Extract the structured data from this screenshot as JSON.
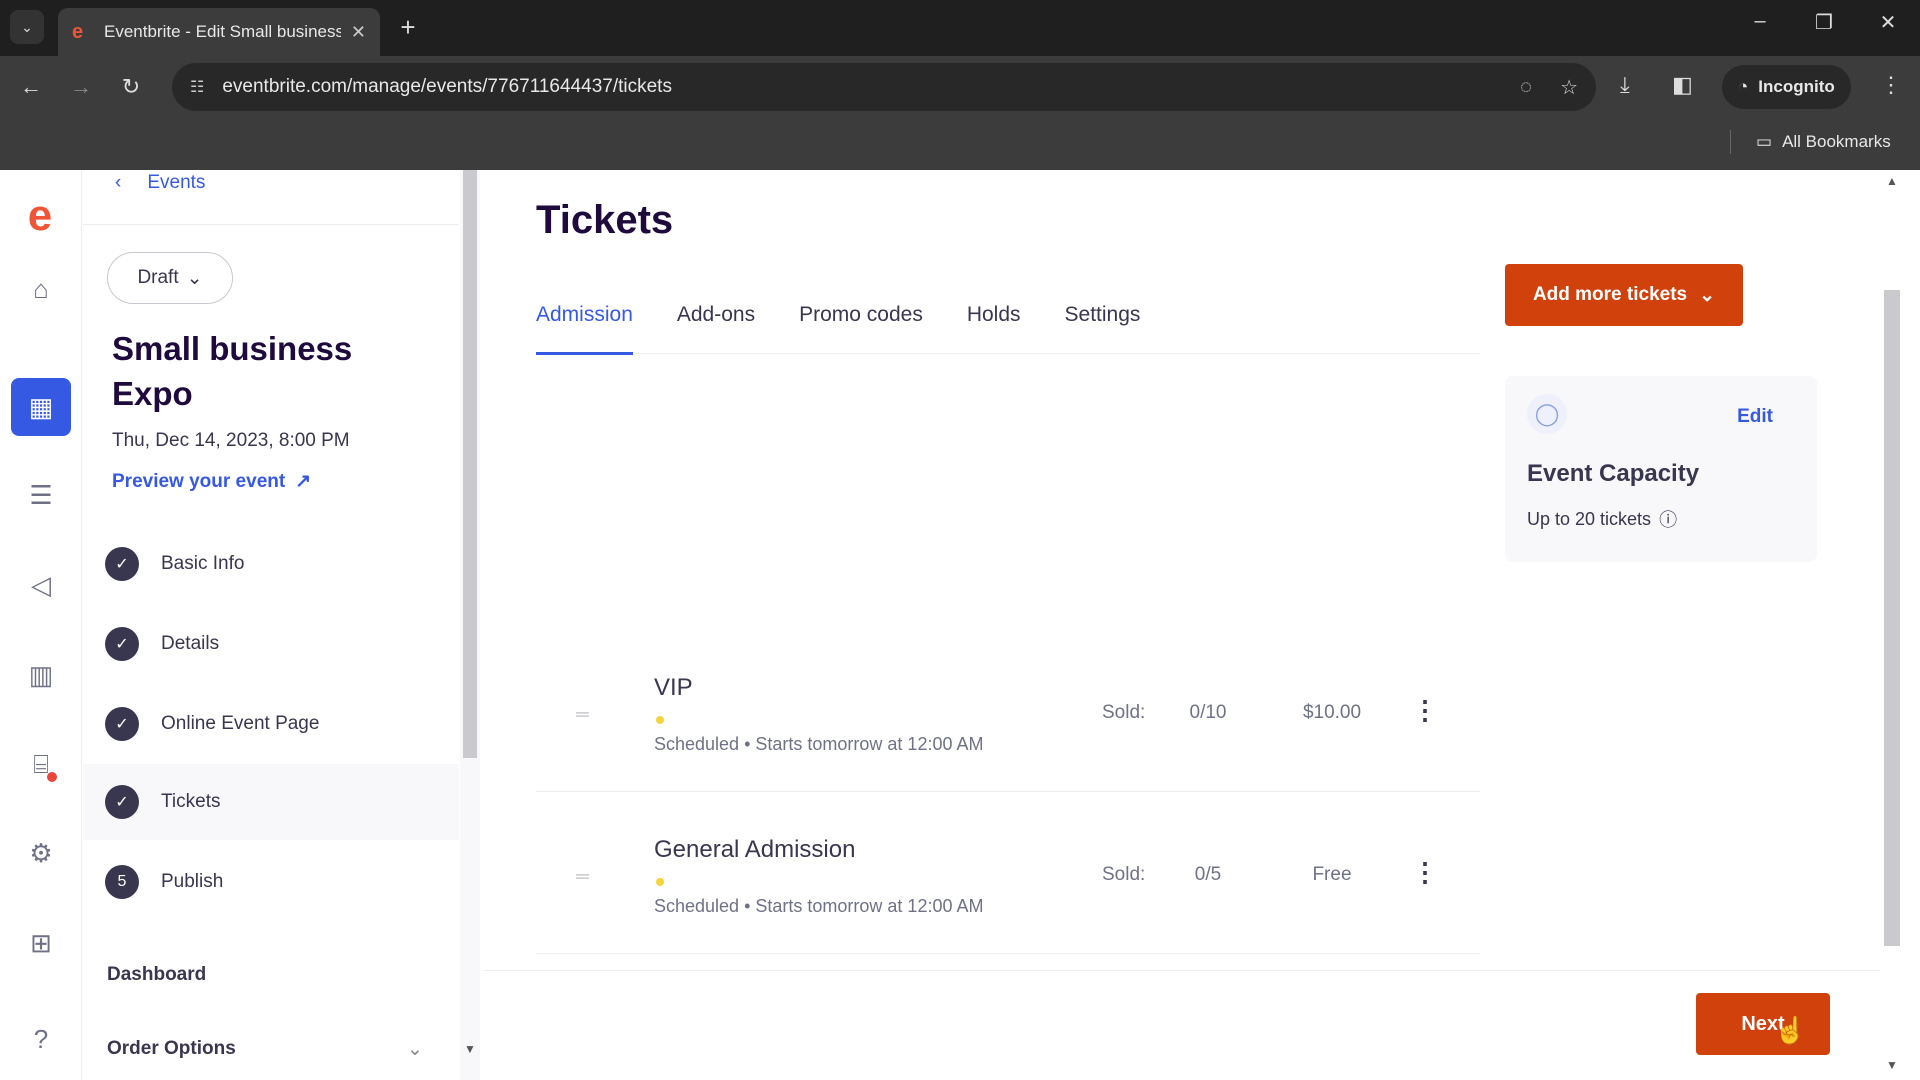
{
  "browser": {
    "tab_title": "Eventbrite - Edit Small business",
    "url": "eventbrite.com/manage/events/776711644437/tickets",
    "incognito_label": "Incognito",
    "bookmarks_label": "All Bookmarks"
  },
  "sidebar": {
    "back_label": "Events",
    "status_label": "Draft",
    "event_title": "Small business Expo",
    "event_date": "Thu, Dec 14, 2023, 8:00 PM",
    "preview_label": "Preview your event",
    "steps": [
      {
        "label": "Basic Info",
        "marker": "✓"
      },
      {
        "label": "Details",
        "marker": "✓"
      },
      {
        "label": "Online Event Page",
        "marker": "✓"
      },
      {
        "label": "Tickets",
        "marker": "✓"
      },
      {
        "label": "Publish",
        "marker": "5"
      }
    ],
    "links": {
      "dashboard": "Dashboard",
      "order_options": "Order Options"
    }
  },
  "main": {
    "title": "Tickets",
    "tabs": [
      "Admission",
      "Add-ons",
      "Promo codes",
      "Holds",
      "Settings"
    ],
    "add_button": "Add more tickets",
    "tickets": [
      {
        "name": "VIP",
        "status": "Scheduled",
        "starts": "Starts tomorrow at 12:00 AM",
        "sold_label": "Sold:",
        "sold": "0/10",
        "price": "$10.00"
      },
      {
        "name": "General Admission",
        "status": "Scheduled",
        "starts": "Starts tomorrow at 12:00 AM",
        "sold_label": "Sold:",
        "sold": "0/5",
        "price": "Free"
      }
    ],
    "capacity": {
      "edit_label": "Edit",
      "title": "Event Capacity",
      "subtitle": "Up to 20 tickets"
    },
    "next_button": "Next"
  },
  "colors": {
    "accent": "#3659e3",
    "brand": "#d1410c",
    "logo": "#f05537"
  }
}
